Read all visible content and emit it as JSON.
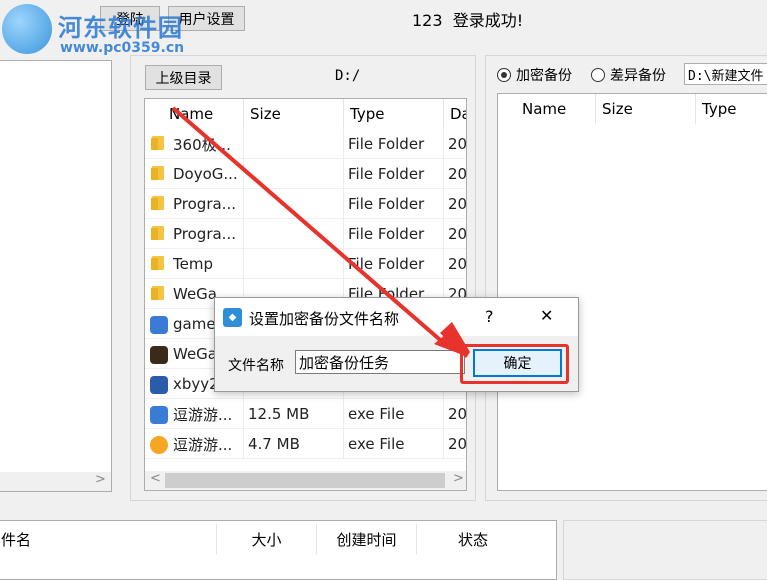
{
  "watermark": {
    "title": "河东软件园",
    "url": "www.pc0359.cn"
  },
  "top": {
    "login_btn": "登陆",
    "user_settings_btn": "用户设置",
    "status": "123  登录成功!"
  },
  "middle": {
    "up_btn": "上级目录",
    "path": "D:/",
    "columns": [
      "Name",
      "Size",
      "Type",
      "Da"
    ],
    "rows": [
      {
        "icon": "folder-icon",
        "name": "360极...",
        "size": "",
        "type": "File Folder",
        "date": "20"
      },
      {
        "icon": "folder-icon",
        "name": "DoyoG...",
        "size": "",
        "type": "File Folder",
        "date": "20"
      },
      {
        "icon": "folder-icon",
        "name": "Progra...",
        "size": "",
        "type": "File Folder",
        "date": "20"
      },
      {
        "icon": "folder-icon",
        "name": "Progra...",
        "size": "",
        "type": "File Folder",
        "date": "20"
      },
      {
        "icon": "folder-icon",
        "name": "Temp",
        "size": "",
        "type": "File Folder",
        "date": "20"
      },
      {
        "icon": "folder-icon",
        "name": "WeGa...",
        "size": "",
        "type": "File Folder",
        "date": "20"
      },
      {
        "icon": "game-icon",
        "name": "game",
        "size": "",
        "type": "",
        "date": ""
      },
      {
        "icon": "wegame-icon",
        "name": "WeGa",
        "size": "",
        "type": "",
        "date": ""
      },
      {
        "icon": "archive-icon",
        "name": "xbyy2",
        "size": "",
        "type": "",
        "date": ""
      },
      {
        "icon": "game-icon",
        "name": "逗游游...",
        "size": "12.5 MB",
        "type": "exe File",
        "date": "20"
      },
      {
        "icon": "download-icon",
        "name": "逗游游...",
        "size": "4.7 MB",
        "type": "exe File",
        "date": "20"
      }
    ]
  },
  "right": {
    "radio_encrypt": "加密备份",
    "radio_diff": "差异备份",
    "path": "D:\\新建文件",
    "columns": [
      "Name",
      "Size",
      "Type"
    ]
  },
  "bottom": {
    "columns": [
      "件名",
      "大小",
      "创建时间",
      "状态"
    ]
  },
  "dialog": {
    "title": "设置加密备份文件名称",
    "help": "?",
    "close": "✕",
    "label": "文件名称",
    "value": "加密备份任务",
    "ok": "确定"
  },
  "colors": {
    "accent": "#0078d7",
    "arrow": "#e8322c",
    "folder": "#f5c542"
  }
}
